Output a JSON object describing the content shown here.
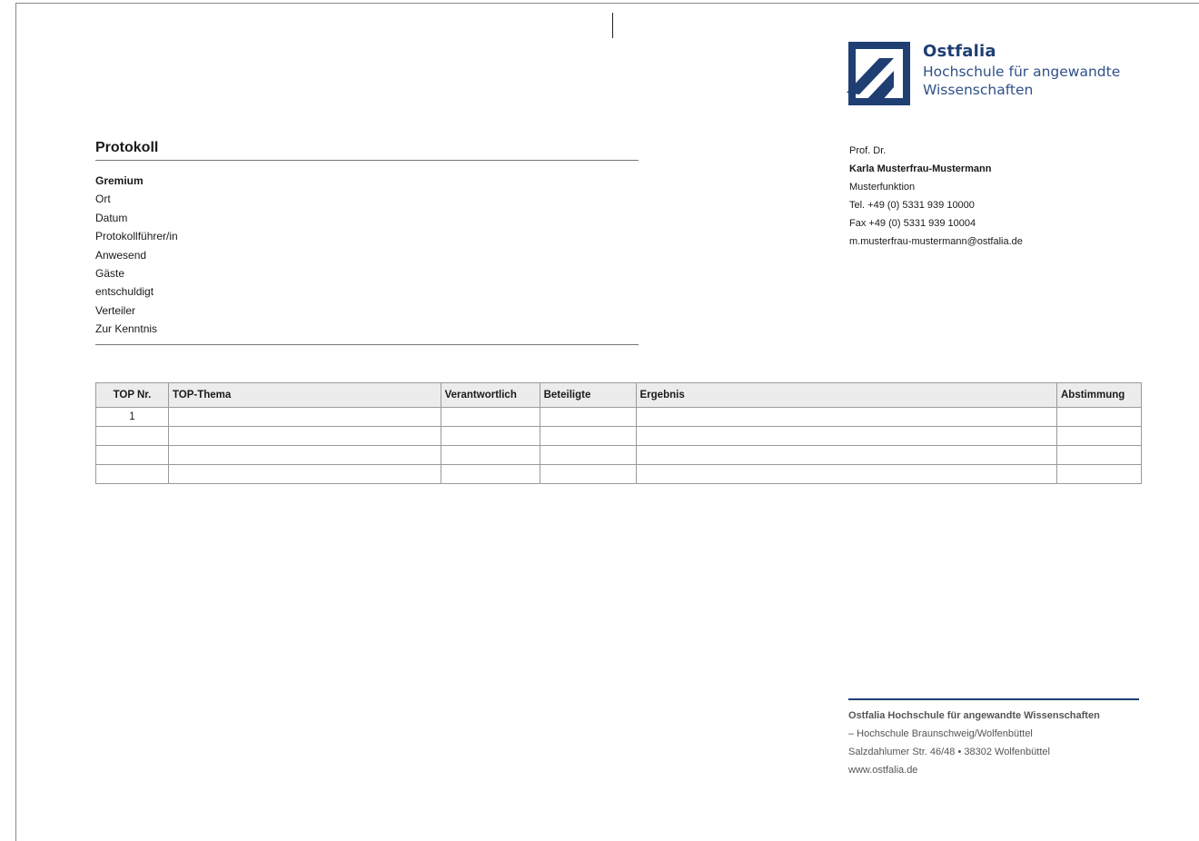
{
  "logo": {
    "name": "Ostfalia",
    "line1": "Hochschule für angewandte",
    "line2": "Wissenschaften"
  },
  "document": {
    "title": "Protokoll",
    "fields": [
      "Gremium",
      "Ort",
      "Datum",
      "Protokollführer/in",
      "Anwesend",
      "Gäste",
      "entschuldigt",
      "Verteiler",
      "Zur Kenntnis"
    ]
  },
  "contact": {
    "title": "Prof. Dr.",
    "name": "Karla Musterfrau-Mustermann",
    "function": "Musterfunktion",
    "tel": "Tel.   +49 (0) 5331 939 10000",
    "fax": "Fax   +49 (0) 5331 939 10004",
    "email": "m.musterfrau-mustermann@ostfalia.de"
  },
  "table": {
    "headers": [
      "TOP Nr.",
      "TOP-Thema",
      "Verantwortlich",
      "Beteiligte",
      "Ergebnis",
      "Abstimmung"
    ],
    "rows": [
      [
        "1",
        "",
        "",
        "",
        "",
        ""
      ],
      [
        "",
        "",
        "",
        "",
        "",
        ""
      ],
      [
        "",
        "",
        "",
        "",
        "",
        ""
      ],
      [
        "",
        "",
        "",
        "",
        "",
        ""
      ]
    ]
  },
  "footer": {
    "org": "Ostfalia Hochschule für angewandte Wissenschaften",
    "sub": "– Hochschule Braunschweig/Wolfenbüttel",
    "address": "Salzdahlumer Str. 46/48 • 38302 Wolfenbüttel",
    "web": "www.ostfalia.de"
  },
  "colors": {
    "brand": "#1f3f73",
    "header_bg": "#ececec"
  }
}
